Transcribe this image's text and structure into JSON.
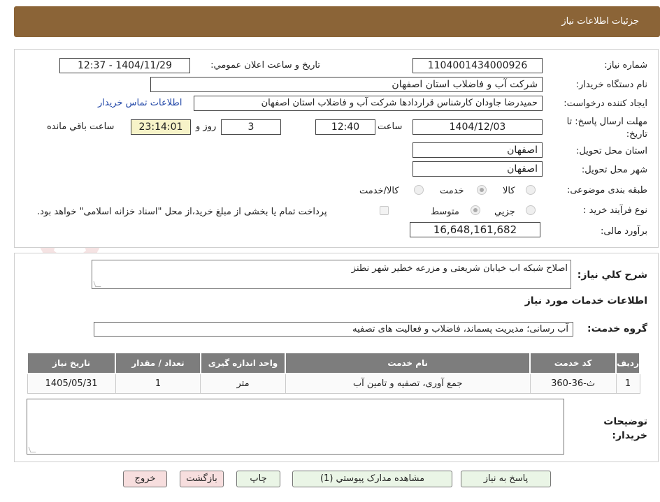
{
  "header": {
    "title": "جزئیات اطلاعات نیاز"
  },
  "form": {
    "need_number_label": "شماره نیاز:",
    "need_number": "1104001434000926",
    "announce_label": "تاریخ و ساعت اعلان عمومي:",
    "announce_value": "1404/11/29 - 12:37",
    "buyer_org_label": "نام دستگاه خريدار:",
    "buyer_org": "شرکت آب و فاضلاب استان اصفهان",
    "requester_label": "ايجاد کننده درخواست:",
    "requester": "حمیدرضا جاودان کارشناس قراردادها شرکت آب و فاضلاب استان اصفهان",
    "buyer_contact_link": "اطلاعات تماس خريدار",
    "deadline_label": "مهلت ارسال پاسخ: تا تاريخ:",
    "deadline_date": "1404/12/03",
    "time_label": "ساعت",
    "deadline_time": "12:40",
    "days_value": "3",
    "days_label": "روز و",
    "remaining_time": "23:14:01",
    "remaining_label": "ساعت باقي مانده",
    "province_label": "استان محل تحويل:",
    "province": "اصفهان",
    "city_label": "شهر محل تحويل:",
    "city": "اصفهان",
    "category_label": "طبقه بندی موضوعی:",
    "category_options": [
      "کالا",
      "خدمت",
      "کالا/خدمت"
    ],
    "category_selected": "خدمت",
    "process_label": "نوع فرآیند خرید :",
    "process_options": [
      "جزیي",
      "متوسط"
    ],
    "process_selected": "متوسط",
    "payment_note": "پرداخت تمام يا بخشی از مبلغ خريد،از محل \"اسناد خزانه اسلامی\" خواهد بود.",
    "budget_label": "برآورد مالی:",
    "budget": "16,648,161,682"
  },
  "description": {
    "label": "شرح کلي نياز:",
    "value": "اصلاح شبکه اب خیابان شریعتی و مزرعه خطیر شهر نطنز"
  },
  "services": {
    "section_title": "اطلاعات خدمات مورد نياز",
    "group_label": "گروه خدمت:",
    "group_value": "آب رسانی؛ مدیریت پسماند، فاضلاب و فعالیت های تصفیه",
    "columns": [
      "رديف",
      "کد خدمت",
      "نام خدمت",
      "واحد اندازه گيری",
      "تعداد / مقدار",
      "تاريخ نياز"
    ],
    "rows": [
      {
        "index": "1",
        "code": "ث-36-360",
        "name": "جمع آوری، تصفیه و تامین آب",
        "unit": "متر",
        "qty": "1",
        "date": "1405/05/31"
      }
    ]
  },
  "buyer_notes": {
    "label": "توضيحات خريدار:",
    "value": ""
  },
  "buttons": {
    "reply": "پاسخ به نياز",
    "attachments": "مشاهده مدارک پيوستي (1)",
    "print": "چاپ",
    "back": "بازگشت",
    "exit": "خروج"
  },
  "watermark": {
    "text": "AriaTender.net"
  },
  "colors": {
    "header_bg": "#8b6437",
    "table_header_bg": "#7d7d7d",
    "button_bg": "#eaf5e6",
    "button_red_bg": "#f7dede"
  }
}
